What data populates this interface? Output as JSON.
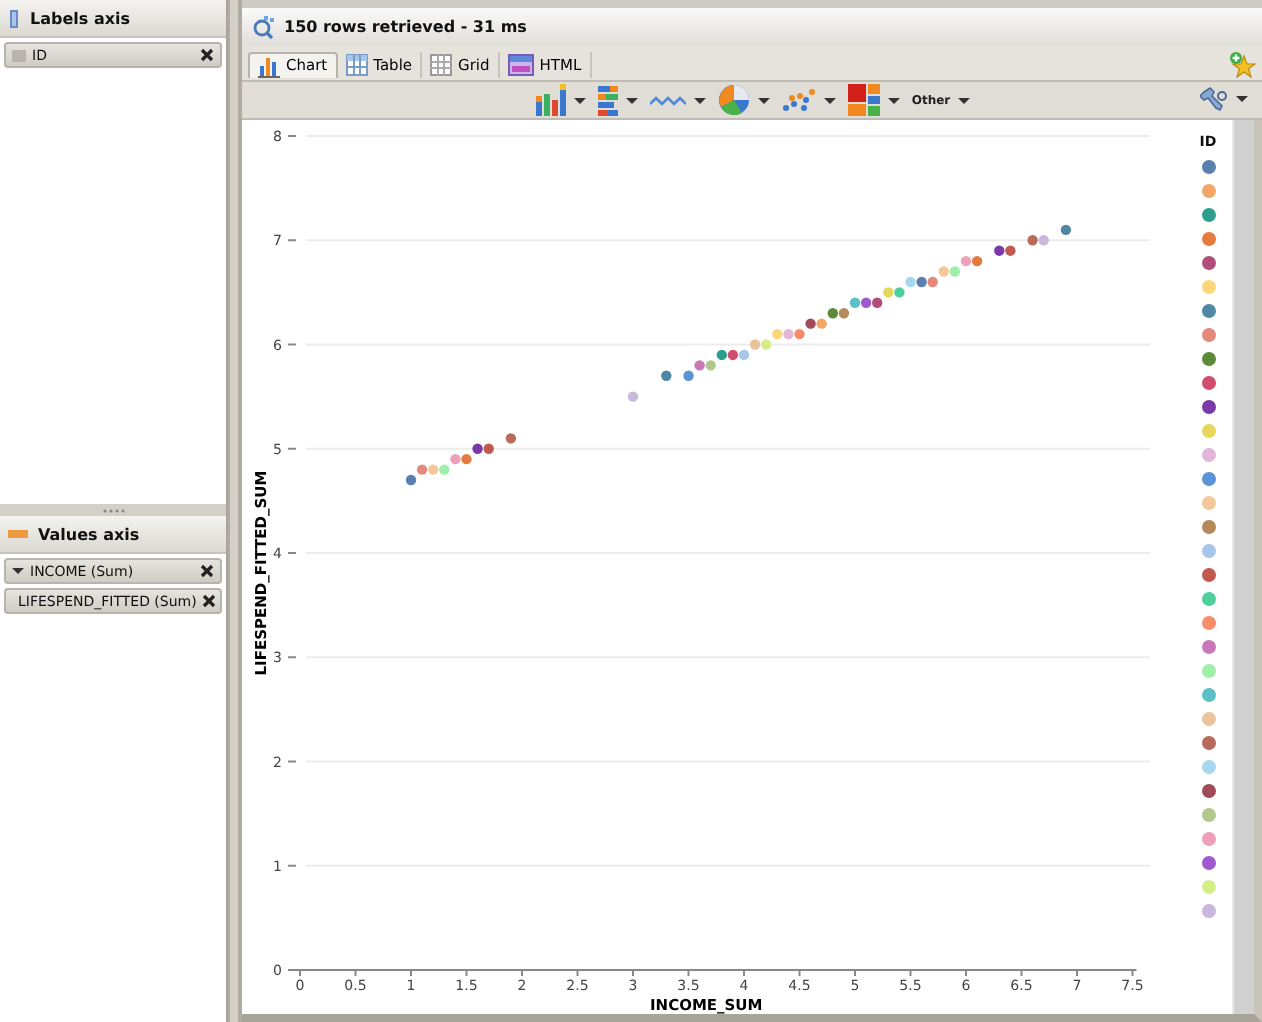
{
  "labels_axis": {
    "title": "Labels axis",
    "items": [
      {
        "label": "ID"
      }
    ]
  },
  "values_axis": {
    "title": "Values axis",
    "items": [
      {
        "label": "INCOME (Sum)"
      },
      {
        "label": "LIFESPEND_FITTED (Sum)"
      }
    ]
  },
  "result": {
    "title": "150 rows retrieved - 31 ms",
    "tabs": [
      {
        "label": "Chart",
        "selected": true
      },
      {
        "label": "Table",
        "selected": false
      },
      {
        "label": "Grid",
        "selected": false
      },
      {
        "label": "HTML",
        "selected": false
      }
    ],
    "toolbar": {
      "other_label": "Other"
    },
    "chart": {
      "chart_data": {
        "type": "scatter",
        "xlabel": "INCOME_SUM",
        "ylabel": "LIFESPEND_FITTED_SUM",
        "x": [
          1.0,
          1.1,
          1.2,
          1.3,
          1.4,
          1.5,
          1.6,
          1.7,
          1.9,
          3.0,
          3.3,
          3.5,
          3.6,
          3.7,
          3.8,
          3.9,
          4.0,
          4.1,
          4.2,
          4.3,
          4.4,
          4.5,
          4.6,
          4.7,
          4.8,
          4.9,
          5.0,
          5.1,
          5.2,
          5.3,
          5.4,
          5.5,
          5.6,
          5.7,
          5.8,
          5.9,
          6.0,
          6.1,
          6.3,
          6.4,
          6.6,
          6.7,
          6.9
        ],
        "series": [
          {
            "values": [
              4.7,
              4.8,
              4.8,
              4.8,
              4.9,
              4.9,
              5.0,
              5.0,
              5.1,
              5.5,
              5.7,
              5.7,
              5.8,
              5.8,
              5.9,
              5.9,
              5.9,
              6.0,
              6.0,
              6.1,
              6.1,
              6.1,
              6.2,
              6.2,
              6.3,
              6.3,
              6.4,
              6.4,
              6.4,
              6.5,
              6.5,
              6.6,
              6.6,
              6.6,
              6.7,
              6.7,
              6.8,
              6.8,
              6.9,
              6.9,
              7.0,
              7.0,
              7.1
            ]
          }
        ],
        "xlim": [
          0,
          7.5
        ],
        "ylim": [
          0,
          8
        ],
        "grid": true,
        "xticks": [
          0,
          0.5,
          1,
          1.5,
          2,
          2.5,
          3,
          3.5,
          4,
          4.5,
          5,
          5.5,
          6,
          6.5,
          7,
          7.5
        ],
        "yticks": [
          0,
          1,
          2,
          3,
          4,
          5,
          6,
          7,
          8
        ]
      },
      "legend": {
        "title": "ID",
        "items": [
          {
            "color": "#5b7fae"
          },
          {
            "color": "#f2a766"
          },
          {
            "color": "#2e9e8c"
          },
          {
            "color": "#e67a3f"
          },
          {
            "color": "#b04d7a"
          },
          {
            "color": "#fbd77a"
          },
          {
            "color": "#4f88a3"
          },
          {
            "color": "#e38a7c"
          },
          {
            "color": "#5c8a3a"
          },
          {
            "color": "#d14d6e"
          },
          {
            "color": "#7a3aa8"
          },
          {
            "color": "#e6d65c"
          },
          {
            "color": "#e2b5d9"
          },
          {
            "color": "#5a93d6"
          },
          {
            "color": "#f5c89a"
          },
          {
            "color": "#b5895a"
          },
          {
            "color": "#a9c6ea"
          },
          {
            "color": "#c05a4f"
          },
          {
            "color": "#4fcf9e"
          },
          {
            "color": "#f98c6a"
          },
          {
            "color": "#c878b8"
          },
          {
            "color": "#9ef0a8"
          },
          {
            "color": "#5cc0c8"
          },
          {
            "color": "#ebc39a"
          },
          {
            "color": "#b86b5a"
          },
          {
            "color": "#a8d8ee"
          },
          {
            "color": "#a04a5a"
          },
          {
            "color": "#b2c88a"
          },
          {
            "color": "#eea0b8"
          },
          {
            "color": "#a05ad0"
          },
          {
            "color": "#d6ee8a"
          },
          {
            "color": "#c8b8dc"
          }
        ]
      }
    }
  }
}
